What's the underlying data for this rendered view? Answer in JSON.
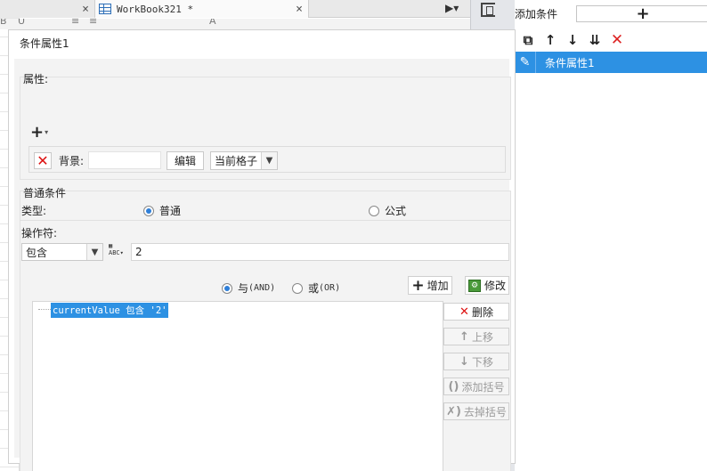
{
  "tabs": [
    {
      "label": "",
      "close": "×"
    },
    {
      "label": "WorkBook321 *",
      "close": "×"
    }
  ],
  "tab_menu": "▶▾",
  "right_panel": {
    "title": "添加条件",
    "add_button": "+",
    "toolbar": [
      "copy-icon",
      "arrow-up-icon",
      "arrow-down-icon",
      "move-bottom-icon",
      "delete-icon"
    ],
    "items": [
      {
        "label": "条件属性1",
        "selected": true
      }
    ]
  },
  "dialog": {
    "title": "条件属性1",
    "properties": {
      "label": "属性:",
      "add_menu": "+",
      "background_label": "背景:",
      "background_value": "",
      "edit_button": "编辑",
      "scope_select": "当前格子"
    },
    "normal_condition": {
      "label": "普通条件",
      "type_label": "类型:",
      "type_options": [
        {
          "label": "普通",
          "checked": true
        },
        {
          "label": "公式",
          "checked": false
        }
      ],
      "operator_label": "操作符:",
      "operator_select": "包含",
      "value": "2"
    },
    "logic": [
      {
        "label": "与",
        "suffix": "(AND)",
        "checked": true
      },
      {
        "label": "或",
        "suffix": "(OR)",
        "checked": false
      }
    ],
    "add_button": "增加",
    "modify_button": "修改",
    "conditions": [
      "currentValue 包含 '2'"
    ],
    "side_buttons": {
      "delete": "删除",
      "move_up": "上移",
      "move_down": "下移",
      "add_bracket": "添加括号",
      "remove_bracket": "去掉括号"
    }
  }
}
